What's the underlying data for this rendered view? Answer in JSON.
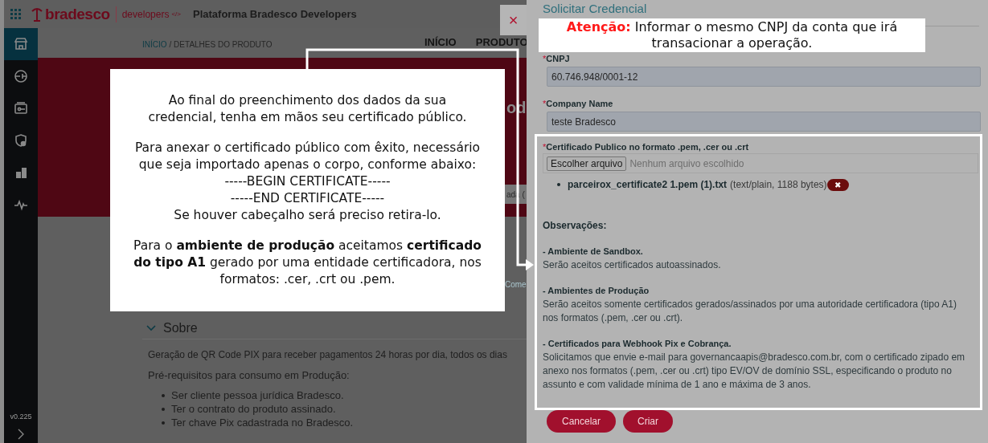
{
  "header": {
    "logo_text": "bradesco",
    "logo_subtext": "developers",
    "logo_code": "</>",
    "app_title": "Plataforma Bradesco Developers"
  },
  "sidebar": {
    "items": [
      {
        "selected": true
      },
      {
        "selected": false
      },
      {
        "selected": false
      },
      {
        "selected": false
      },
      {
        "selected": false
      },
      {
        "selected": false
      }
    ],
    "version": "v0.225"
  },
  "breadcrumb": {
    "link": "INÍCIO",
    "current": "/ DETALHES DO PRODUTO"
  },
  "nav": [
    "INÍCIO",
    "PRODUTO"
  ],
  "fragments": [
    {
      "kind": "heading",
      "text": "od"
    },
    {
      "kind": "button",
      "text": "ada ("
    },
    {
      "kind": "link",
      "text": "Come"
    }
  ],
  "about": {
    "title": "Sobre",
    "expanded": true,
    "description": "Geração de QR Code PIX para receber pagamentos 24 horas por dia, todos os dias",
    "prereq_title": "Pré-requisitos para consumo em Produção:",
    "prereqs": [
      "Ser cliente pessoa jurídica Bradesco.",
      "Ter o contrato do produto assinado.",
      "Ter chave Pix cadastrada no Bradesco."
    ]
  },
  "close_button": "×",
  "callout": {
    "paragraphs": [
      [
        "Ao final do preenchimento dos dados da sua credencial, tenha em mãos seu certificado público."
      ],
      [
        "Para anexar o certificado público com êxito, necessário que seja importado apenas o corpo, conforme abaixo:",
        "-----BEGIN CERTIFICATE-----",
        "-----END CERTIFICATE-----",
        "Se houver cabeçalho será preciso retira-lo."
      ],
      [
        "Para o **ambiente de produção** aceitamos **certificado do tipo A1** gerado por  uma entidade certificadora, nos formatos: .cer, .crt ou .pem."
      ]
    ]
  },
  "drawer": {
    "title": "Solicitar Credencial",
    "required_mark": "*",
    "attention": {
      "label": "Atenção:",
      "text": "Informar o mesmo CNPJ da conta que irá transacionar a operação."
    },
    "fields": [
      {
        "label": "CNPJ",
        "required": true,
        "value": "60.746.948/0001-12"
      },
      {
        "label": "Company Name",
        "required": true,
        "value": "teste Bradesco"
      }
    ],
    "certificate": {
      "label": "Certificado Publico no formato .pem, .cer ou .crt",
      "required": true,
      "choose_button": "Escolher arquivo",
      "no_file": "Nenhum arquivo escolhido",
      "files": [
        {
          "name": "parceirox_certificate2 1.pem (1).txt",
          "info": "(text/plain, 1188 bytes)",
          "remove": "✖"
        }
      ]
    },
    "notes_title": "Observações:",
    "notes": [
      {
        "title": "- Ambiente de Sandbox.",
        "text": "Serão aceitos certificados autoassinados."
      },
      {
        "title": "- Ambientes de Produção",
        "text": "Serão aceitos somente certificados gerados/assinados por uma autoridade certificadora (tipo A1) nos formatos (.pem, .cer ou .crt)."
      },
      {
        "title": "- Certificados para Webhook Pix e Cobrança.",
        "text": "Solicitamos que envie e-mail para governancaapis@bradesco.com.br, com o certificado zipado em anexo nos formatos (.pem, .cer ou .crt) tipo EV/OV de domínio SSL, especificando o produto no assunto e com validade mínima de 1 ano e máxima de 3 anos."
      }
    ],
    "buttons": [
      "Cancelar",
      "Criar"
    ]
  }
}
